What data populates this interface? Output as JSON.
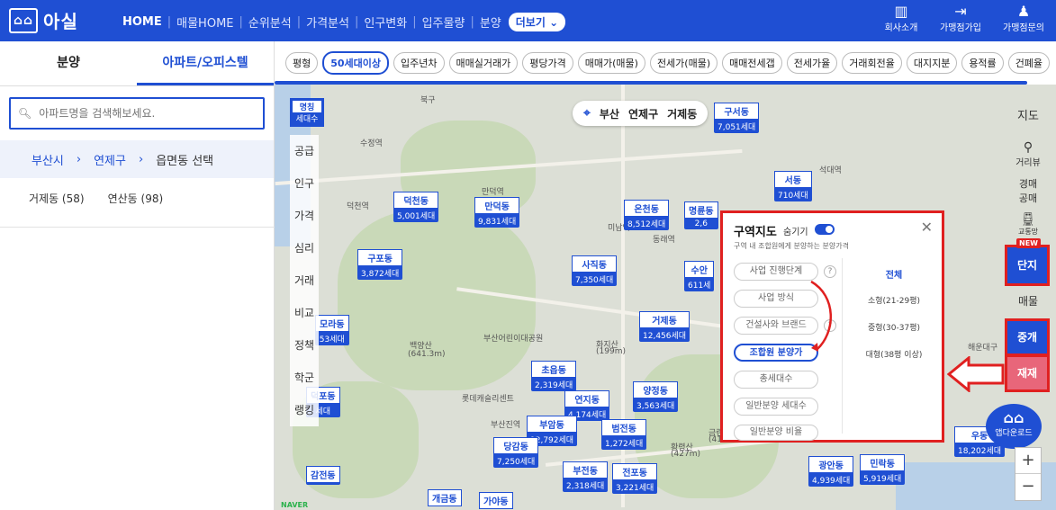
{
  "header": {
    "logo": "아실",
    "nav": [
      "HOME",
      "매물HOME",
      "순위분석",
      "가격분석",
      "인구변화",
      "입주물량",
      "분양"
    ],
    "more": "더보기",
    "right": [
      {
        "icon": "building-icon",
        "label": "회사소개"
      },
      {
        "icon": "login-icon",
        "label": "가맹점가입"
      },
      {
        "icon": "people-icon",
        "label": "가맹점문의"
      }
    ]
  },
  "left": {
    "tabs": [
      "분양",
      "아파트/오피스텔"
    ],
    "search_placeholder": "아파트명을 검색해보세요.",
    "breadcrumb": [
      "부산시",
      "연제구",
      "읍면동 선택"
    ],
    "dongs": [
      "거제동 (58)",
      "연산동 (98)"
    ]
  },
  "filters": [
    "평형",
    "50세대이상",
    "입주년차",
    "매매실거래가",
    "평당가격",
    "매매가(매물)",
    "전세가(매물)",
    "매매전세갭",
    "전세가율",
    "거래회전율",
    "대지지분",
    "용적률",
    "건폐율"
  ],
  "map_nav": [
    "부산",
    "연제구",
    "거제동"
  ],
  "legend": {
    "title": "명칭",
    "sub": "세대수"
  },
  "side_menu": [
    "공급",
    "인구",
    "가격",
    "심리",
    "거래",
    "비교",
    "정책",
    "학군",
    "랭킹"
  ],
  "markers": [
    {
      "name": "덕천동",
      "value": "5,001세대"
    },
    {
      "name": "만덕동",
      "value": "9,831세대"
    },
    {
      "name": "온천동",
      "value": "8,512세대"
    },
    {
      "name": "명륜동",
      "value": "2,6"
    },
    {
      "name": "구포동",
      "value": "3,872세대"
    },
    {
      "name": "사직동",
      "value": "7,350세대"
    },
    {
      "name": "수안",
      "value": "611세"
    },
    {
      "name": "거제동",
      "value": "12,456세대"
    },
    {
      "name": "초읍동",
      "value": "2,319세대"
    },
    {
      "name": "연지동",
      "value": "4,174세대"
    },
    {
      "name": "양정동",
      "value": "3,563세대"
    },
    {
      "name": "부암동",
      "value": "12,792세대"
    },
    {
      "name": "범전동",
      "value": "1,272세대"
    },
    {
      "name": "당감동",
      "value": "7,250세대"
    },
    {
      "name": "부전동",
      "value": "2,318세대"
    },
    {
      "name": "전포동",
      "value": "3,221세대"
    },
    {
      "name": "감전동",
      "value": ""
    },
    {
      "name": "개금동",
      "value": ""
    },
    {
      "name": "가야동",
      "value": ""
    },
    {
      "name": "서동",
      "value": "710세대"
    },
    {
      "name": "구서동",
      "value": "7,051세대"
    },
    {
      "name": "광안동",
      "value": "4,939세대"
    },
    {
      "name": "민락동",
      "value": "5,919세대"
    },
    {
      "name": "우동",
      "value": "18,202세대"
    },
    {
      "name": "모라동",
      "value": "53세대"
    },
    {
      "name": "덕포동",
      "value": "세대"
    }
  ],
  "map_labels": [
    "북구",
    "수정역",
    "덕천역",
    "만덕역",
    "미남역",
    "동래역",
    "백양산",
    "(641.3m)",
    "부산어린이대공원",
    "화지산",
    "(199m)",
    "롯데캐슬리센트",
    "부산진역",
    "황령산",
    "(427m)",
    "금련산",
    "(413.6m)",
    "석대역",
    "해운대구"
  ],
  "popup": {
    "title": "구역지도",
    "hide_label": "숨기기",
    "desc": "구역 내 조합원에게 분양하는 분양가격",
    "options": [
      "사업 진행단계",
      "사업 방식",
      "건설사와 브랜드",
      "조합원 분양가",
      "총세대수",
      "일반분양 세대수",
      "일반분양 비율"
    ],
    "sizes": [
      "전체",
      "소형(21-29평)",
      "중형(30-37평)",
      "대형(38평 이상)"
    ]
  },
  "right_tools": {
    "map": "지도",
    "distance": "거리뷰",
    "auction": "경매\n공매",
    "transit": "교통망",
    "new": "NEW",
    "danji": "단지",
    "maemul": "매물",
    "junggae": "중개",
    "jaejae": "재재",
    "app": "앱다운로드",
    "zoom_in": "+",
    "zoom_out": "−"
  },
  "naver": "NAVER"
}
